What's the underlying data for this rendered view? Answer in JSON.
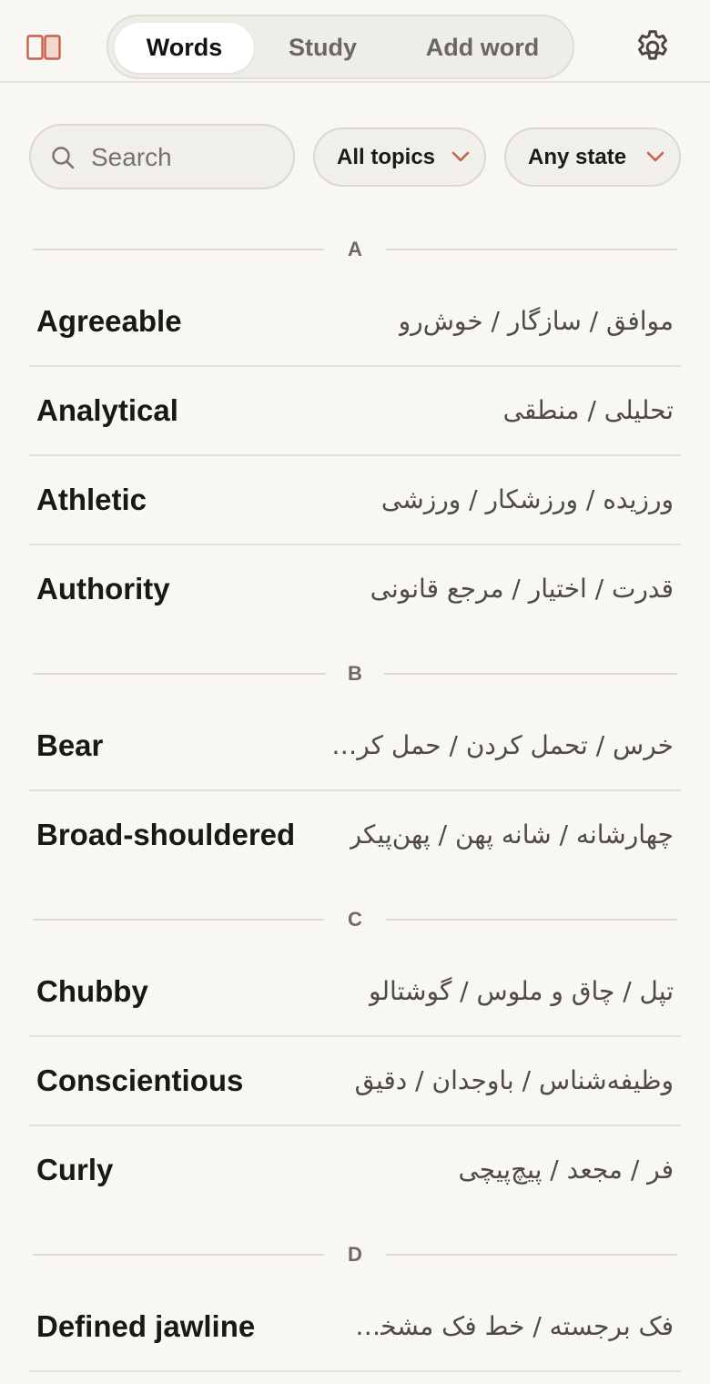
{
  "tabs": [
    {
      "label": "Words",
      "active": true
    },
    {
      "label": "Study",
      "active": false
    },
    {
      "label": "Add word",
      "active": false
    }
  ],
  "search": {
    "placeholder": "Search",
    "value": ""
  },
  "filters": {
    "topic": "All topics",
    "state": "Any state"
  },
  "colors": {
    "accent": "#c8614a",
    "background": "#f8f7f3"
  },
  "icons": {
    "logo": "book-open-icon",
    "settings": "gear-icon",
    "search": "search-icon",
    "dropdown": "chevron-down-icon"
  },
  "sections": [
    {
      "letter": "A",
      "words": [
        {
          "en": "Agreeable",
          "fa": "موافق / سازگار / خوش‌رو"
        },
        {
          "en": "Analytical",
          "fa": "تحلیلی / منطقی"
        },
        {
          "en": "Athletic",
          "fa": "ورزیده / ورزشکار / ورزشی"
        },
        {
          "en": "Authority",
          "fa": "قدرت / اختیار / مرجع قانونی"
        }
      ]
    },
    {
      "letter": "B",
      "words": [
        {
          "en": "Bear",
          "fa": "خرس / تحمل کردن / حمل کردن"
        },
        {
          "en": "Broad-shouldered",
          "fa": "چهارشانه / شانه پهن / پهن‌پیکر"
        }
      ]
    },
    {
      "letter": "C",
      "words": [
        {
          "en": "Chubby",
          "fa": "تپل / چاق و ملوس / گوشتالو"
        },
        {
          "en": "Conscientious",
          "fa": "وظیفه‌شناس / باوجدان / دقیق"
        },
        {
          "en": "Curly",
          "fa": "فر / مجعد / پیچ‌پیچی"
        }
      ]
    },
    {
      "letter": "D",
      "words": [
        {
          "en": "Defined jawline",
          "fa": "فک برجسته / خط فک مشخص..."
        }
      ]
    }
  ]
}
